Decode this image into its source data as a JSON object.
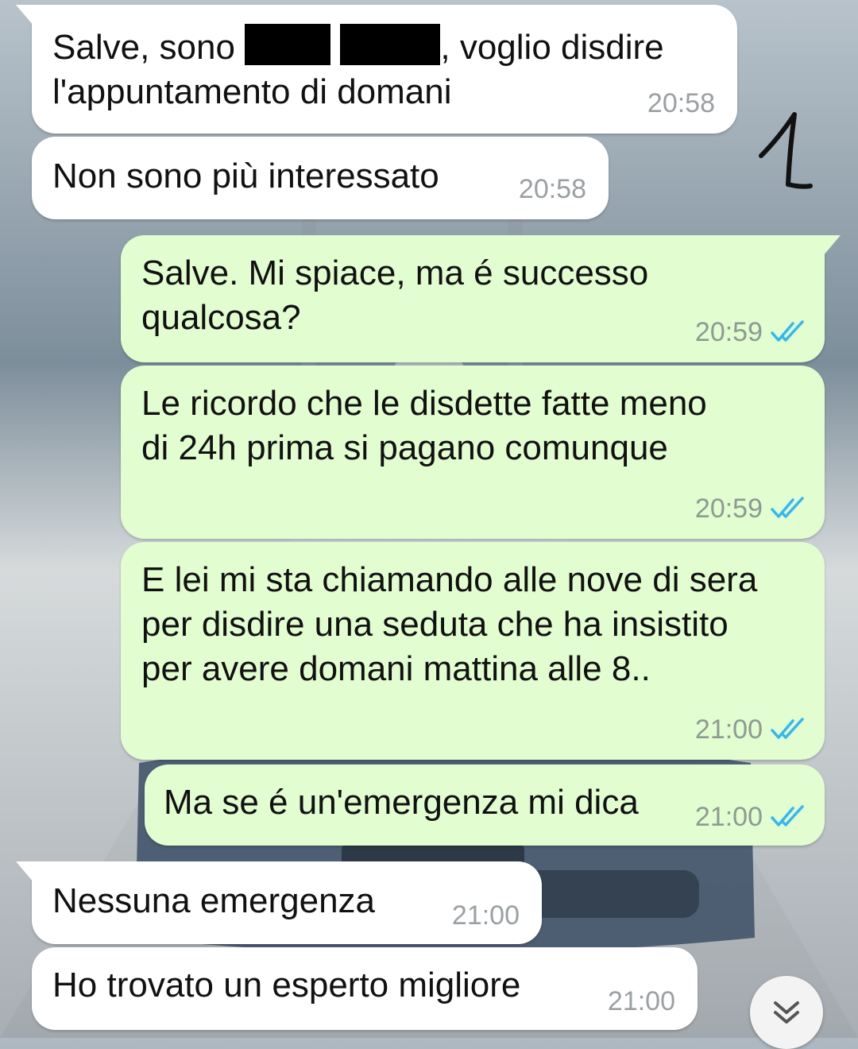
{
  "annotation": {
    "number": "1"
  },
  "messages": [
    {
      "direction": "in",
      "text_before": "Salve, sono ",
      "text_after": ", voglio disdire\nl'appuntamento di domani",
      "time": "20:58",
      "redacted": true
    },
    {
      "direction": "in",
      "text": "Non sono più interessato",
      "time": "20:58"
    },
    {
      "direction": "out",
      "text": "Salve. Mi spiace, ma é successo\nqualcosa?",
      "time": "20:59",
      "status": "read"
    },
    {
      "direction": "out",
      "text": "Le ricordo che le disdette fatte meno\ndi 24h prima si pagano comunque",
      "time": "20:59",
      "status": "read"
    },
    {
      "direction": "out",
      "text": "E lei mi sta chiamando alle nove di sera\nper disdire una seduta che ha insistito\nper avere domani mattina alle 8..",
      "time": "21:00",
      "status": "read"
    },
    {
      "direction": "out",
      "text": "Ma se é un'emergenza mi dica",
      "time": "21:00",
      "status": "read"
    },
    {
      "direction": "in",
      "text": "Nessuna emergenza",
      "time": "21:00"
    },
    {
      "direction": "in",
      "text": "Ho trovato un esperto migliore",
      "time": "21:00"
    }
  ],
  "icons": {
    "read_receipt": "double-check-icon",
    "scroll_down": "chevrons-down-icon"
  },
  "colors": {
    "incoming_bg": "#ffffff",
    "outgoing_bg": "#e2fdd0",
    "read_tick": "#34b7f1"
  }
}
